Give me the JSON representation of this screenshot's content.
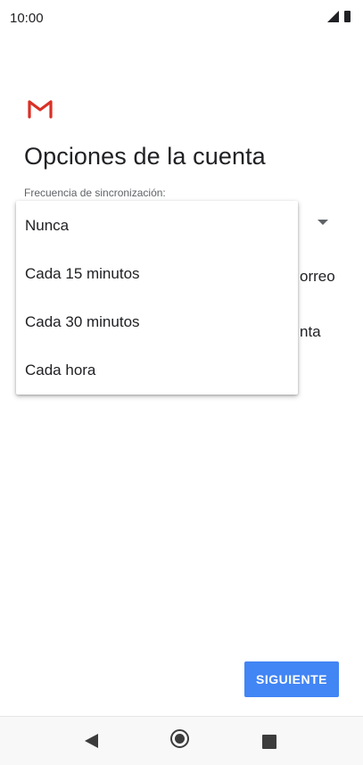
{
  "status_bar": {
    "time": "10:00"
  },
  "page": {
    "title": "Opciones de la cuenta",
    "field_label": "Frecuencia de sincronización:",
    "background_fragments": [
      "orreo",
      "nta"
    ]
  },
  "dropdown": {
    "options": [
      "Nunca",
      "Cada 15 minutos",
      "Cada 30 minutos",
      "Cada hora"
    ]
  },
  "buttons": {
    "next_label": "SIGUIENTE"
  },
  "colors": {
    "accent": "#4285f4",
    "gmail_red": "#d93025"
  },
  "icons": {
    "logo": "gmail-icon",
    "nav": [
      "back-icon",
      "home-icon",
      "recents-icon"
    ],
    "status": [
      "signal-icon",
      "battery-icon"
    ]
  }
}
